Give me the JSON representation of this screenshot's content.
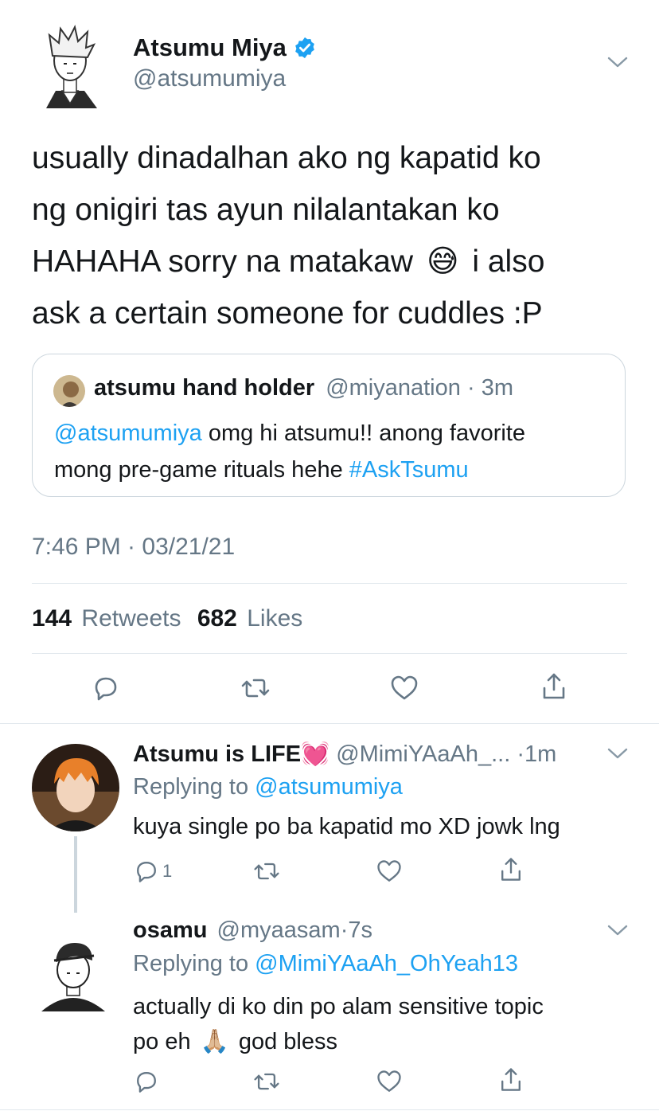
{
  "tweet": {
    "author_name": "Atsumu Miya",
    "author_handle": "@atsumumiya",
    "text_lines": [
      "usually dinadalhan ako ng kapatid ko",
      "ng onigiri tas ayun nilalantakan ko",
      "HAHAHA sorry na matakaw",
      "i also",
      "ask a certain someone for cuddles :P"
    ],
    "emoji": "😅",
    "timestamp": "7:46 PM · 03/21/21",
    "retweets_count": "144",
    "retweets_label": "Retweets",
    "likes_count": "682",
    "likes_label": "Likes"
  },
  "quoted": {
    "name": "atsumu hand holder",
    "handle": "@miyanation",
    "sep": "·",
    "time": "3m",
    "mention": "@atsumumiya",
    "line1_text": " omg hi atsumu!! anong favorite",
    "line2_text": "mong pre-game rituals hehe ",
    "hashtag": "#AskTsumu"
  },
  "replies": [
    {
      "name": "Atsumu is LIFE",
      "emoji": "💓",
      "handle": "@MimiYAaAh_...",
      "sep": "·",
      "time": "1m",
      "replying_prefix": "Replying to ",
      "replying_to": "@atsumumiya",
      "text": "kuya single po ba kapatid mo XD jowk lng",
      "reply_count": "1"
    },
    {
      "name": "osamu",
      "handle": "@myaasam",
      "sep": "·",
      "time": "7s",
      "replying_prefix": "Replying to ",
      "replying_to": "@MimiYAaAh_OhYeah13",
      "text_line1": "actually di ko din po alam sensitive topic",
      "text_line2_a": "po eh",
      "emoji": "🙏🏼",
      "text_line2_b": "god bless"
    }
  ],
  "colors": {
    "accent": "#1da1f2",
    "muted": "#657786",
    "divider": "#e1e8ed"
  }
}
